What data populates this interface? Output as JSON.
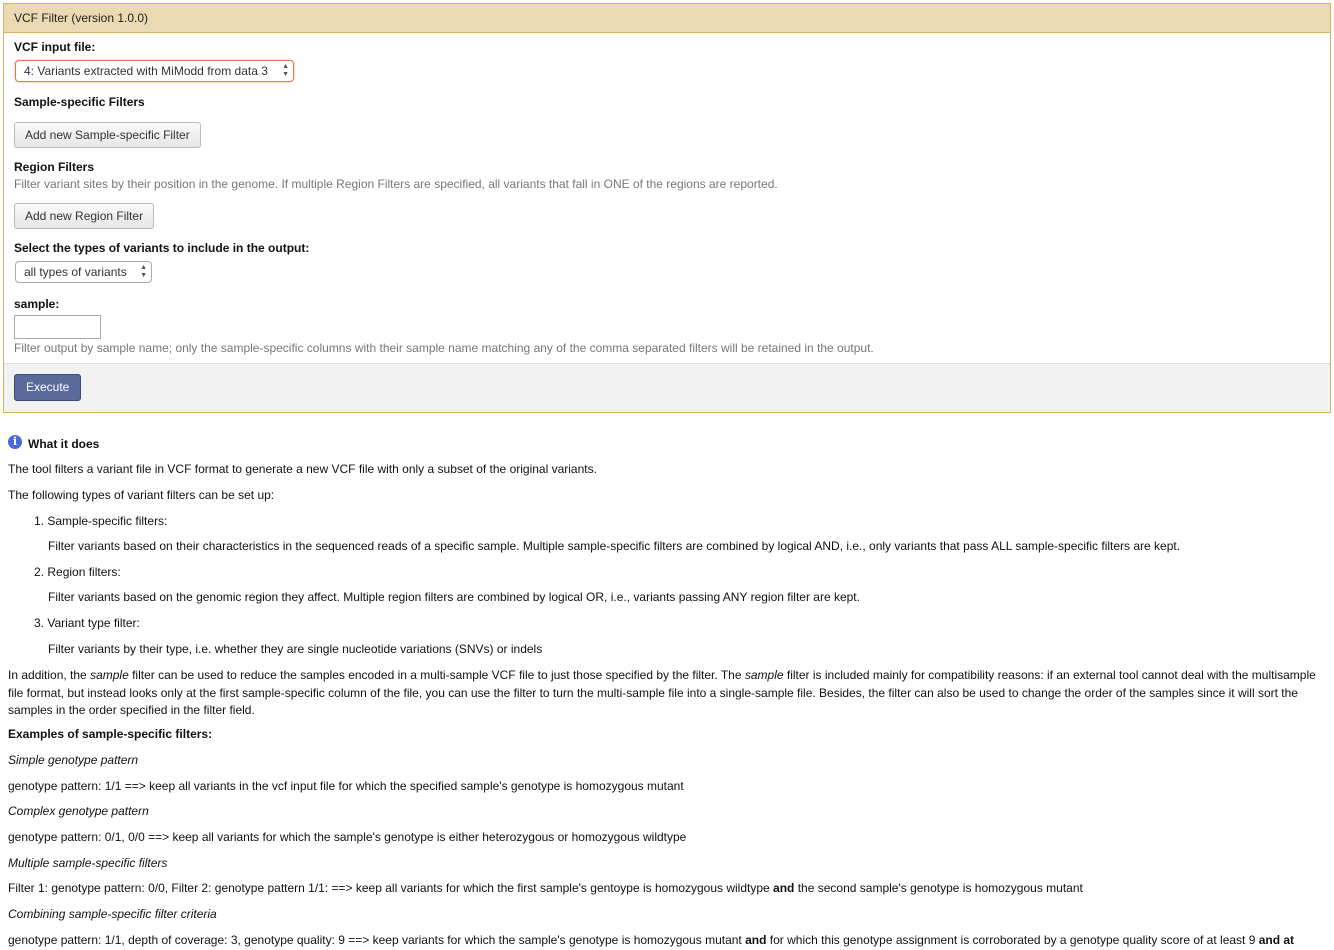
{
  "panel": {
    "title": "VCF Filter (version 1.0.0)"
  },
  "form": {
    "vcf_input_label": "VCF input file:",
    "vcf_input_value": "4: Variants extracted with MiModd from data 3",
    "sample_filters_label": "Sample-specific Filters",
    "add_sample_filter_button": "Add new Sample-specific Filter",
    "region_filters_label": "Region Filters",
    "region_filters_help": "Filter variant sites by their position in the genome. If multiple Region Filters are specified, all variants that fall in ONE of the regions are reported.",
    "add_region_filter_button": "Add new Region Filter",
    "variant_types_label": "Select the types of variants to include in the output:",
    "variant_types_value": "all types of variants",
    "sample_label": "sample:",
    "sample_value": "",
    "sample_help": "Filter output by sample name; only the sample-specific columns with their sample name matching any of the comma separated filters will be retained in the output.",
    "execute_button": "Execute"
  },
  "help": {
    "heading": "What it does",
    "intro": "The tool filters a variant file in VCF format to generate a new VCF file with only a subset of the original variants.",
    "types_intro": "The following types of variant filters can be set up:",
    "list": [
      {
        "num": "1.",
        "title": "Sample-specific filters:",
        "desc": "Filter variants based on their characteristics in the sequenced reads of a specific sample. Multiple sample-specific filters are combined by logical AND, i.e., only variants that pass ALL sample-specific filters are kept."
      },
      {
        "num": "2.",
        "title": "Region filters:",
        "desc": "Filter variants based on the genomic region they affect. Multiple region filters are combined by logical OR, i.e., variants passing ANY region filter are kept."
      },
      {
        "num": "3.",
        "title": "Variant type filter:",
        "desc": "Filter variants by their type, i.e. whether they are single nucleotide variations (SNVs) or indels"
      }
    ],
    "addition": {
      "p1": "In addition, the ",
      "em1": "sample",
      "p2": " filter can be used to reduce the samples encoded in a multi-sample VCF file to just those specified by the filter. The ",
      "em2": "sample",
      "p3": " filter is included mainly for compatibility reasons: if an external tool cannot deal with the multisample file format, but instead looks only at the first sample-specific column of the file, you can use the filter to turn the multi-sample file into a single-sample file. Besides, the filter can also be used to change the order of the samples since it will sort the samples in the order specified in the filter field."
    },
    "examples_heading": "Examples of sample-specific filters:",
    "ex1_title": "Simple genotype pattern",
    "ex1_text": "genotype pattern: 1/1 ==> keep all variants in the vcf input file for which the specified sample's genotype is homozygous mutant",
    "ex2_title": "Complex genotype pattern",
    "ex2_text": "genotype pattern: 0/1, 0/0 ==> keep all variants for which the sample's genotype is either heterozygous or homozygous wildtype",
    "ex3_title": "Multiple sample-specific filters",
    "ex3_a": "Filter 1: genotype pattern: 0/0, Filter 2: genotype pattern 1/1: ==> keep all variants for which the first sample's gentoype is homozygous wildtype ",
    "ex3_and": "and",
    "ex3_b": " the second sample's genotype is homozygous mutant",
    "ex4_title": "Combining sample-specific filter criteria",
    "ex4_a": "genotype pattern: 1/1, depth of coverage: 3, genotype quality: 9 ==> keep variants for which the sample's genotype is homozygous mutant ",
    "ex4_and1": "and",
    "ex4_b": " for which this genotype assignment is corroborated by a genotype quality score of at least 9 ",
    "ex4_and2": "and at"
  },
  "icons": {
    "info": "info-icon",
    "select_arrows": "updown-arrows-icon"
  }
}
